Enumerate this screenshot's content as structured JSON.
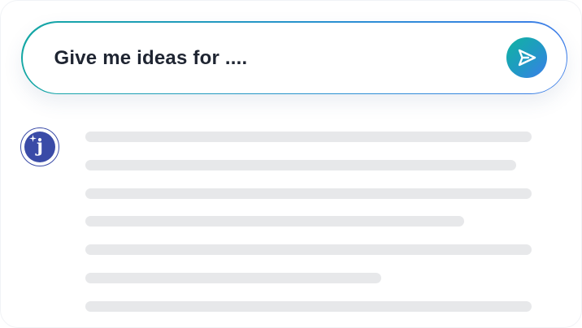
{
  "prompt": {
    "text": "Give me ideas for ....",
    "send_icon": "send-icon"
  },
  "assistant": {
    "avatar_letter": "j",
    "avatar_icon": "sparkle-icon"
  },
  "colors": {
    "accent_start": "#14a7a4",
    "accent_end": "#3e7ee8",
    "avatar": "#3a4ba7",
    "skeleton": "#e7e8ea",
    "text": "#1f2532"
  }
}
